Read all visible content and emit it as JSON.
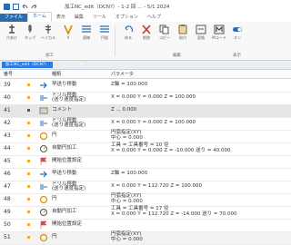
{
  "window": {
    "title": "加工NC_edit（DCN?）- 1-2 回 ... - 5/1 2024"
  },
  "tabs": [
    "ファイル",
    "ホーム",
    "表示",
    "編集",
    "ツール",
    "オプション",
    "ヘルプ"
  ],
  "ribbon": {
    "buttons": [
      "穴あけ",
      "タップ",
      "ヘリカル",
      "V",
      "直線",
      "円弧",
      "戻る",
      "削除",
      "コピー",
      "貼付",
      "変換",
      "Mコード",
      "オン"
    ],
    "groups": [
      "加工",
      "編集",
      "表示"
    ]
  },
  "document_tab": {
    "label": "加工NC_edit（DCN?）",
    "close": "×"
  },
  "columns": [
    "番号",
    "種類",
    "パラメータ"
  ],
  "rows": [
    {
      "num": "39",
      "name": "早送り移動",
      "p1": "Z軸 = 100.000",
      "p2": "",
      "name2": "",
      "selected": false,
      "tag": "#f5a623",
      "icon": "arrow"
    },
    {
      "num": "40",
      "name": "ドリル移動",
      "name2": "(送り速度指定)",
      "p1": "X = 0.000  Y = 0.000  Z = 100.000",
      "p2": "",
      "selected": false,
      "tag": "#f5a623",
      "icon": "drill"
    },
    {
      "num": "41",
      "name": "コメント",
      "p1": "Z ... 0.000",
      "p2": "",
      "name2": "",
      "selected": true,
      "tag": "#555555",
      "icon": "comment"
    },
    {
      "num": "42",
      "name": "ドリル移動",
      "name2": "(送り速度指定)",
      "p1": "X = 0.000  Y = 0.000  Z = 100.000",
      "p2": "",
      "selected": false,
      "tag": "#f5a623",
      "icon": "drill"
    },
    {
      "num": "43",
      "name": "円",
      "p1": "円弧指定(XY)",
      "p2": "中心 = 0.000",
      "name2": "",
      "selected": false,
      "tag": "#f5a623",
      "icon": "circle"
    },
    {
      "num": "44",
      "name": "自動円加工",
      "p1": "工具 = 工具番号 = 10  径",
      "p2": "X = 0.000  Y = 0.000  Z = -10.000  送り = 40.000",
      "name2": "",
      "selected": false,
      "tag": "#f5a623",
      "icon": "autocircle"
    },
    {
      "num": "45",
      "name": "開始位置設定",
      "p1": "",
      "p2": "",
      "name2": "",
      "selected": false,
      "tag": "#f5a623",
      "icon": "flag"
    },
    {
      "num": "46",
      "name": "早送り移動",
      "p1": "Z軸 = 100.000",
      "p2": "",
      "name2": "",
      "selected": false,
      "tag": "#f5a623",
      "icon": "arrow"
    },
    {
      "num": "47",
      "name": "ドリル移動",
      "name2": "(送り速度指定)",
      "p1": "X = 0.000  Y = 112.720  Z = 100.000",
      "p2": "",
      "selected": false,
      "tag": "#f5a623",
      "icon": "drill"
    },
    {
      "num": "48",
      "name": "円",
      "p1": "円弧指定(XY)",
      "p2": "中心 = 0.000",
      "name2": "",
      "selected": false,
      "tag": "#f5a623",
      "icon": "circle"
    },
    {
      "num": "49",
      "name": "自動円加工",
      "p1": "工具 = 工具番号 = 17  径",
      "p2": "X = 0.000  Y = 112.720  Z = -14.000  送り = 70.000",
      "name2": "",
      "selected": false,
      "tag": "#f5a623",
      "icon": "autocircle"
    },
    {
      "num": "50",
      "name": "開始位置設定",
      "p1": "",
      "p2": "",
      "name2": "",
      "selected": false,
      "tag": "#f5a623",
      "icon": "flag"
    },
    {
      "num": "51",
      "name": "円",
      "p1": "円弧指定(XY)",
      "p2": "中心 = 0.000",
      "name2": "",
      "selected": false,
      "tag": "#f5a623",
      "icon": "circle"
    }
  ]
}
